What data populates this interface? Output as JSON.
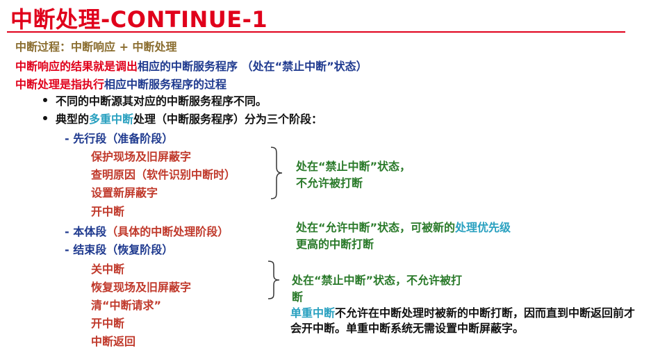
{
  "title": "中断处理-CONTINUE-1",
  "colors": {
    "red": "#e0001b",
    "brown": "#8a6d2f",
    "blue": "#1f3a8f",
    "green": "#2a7a2a",
    "teal": "#2aa1c0",
    "darkred": "#c0392b"
  },
  "line1": {
    "text": "中断过程：中断响应 + 中断处理"
  },
  "line2": {
    "p1": "中断响应的结果就是",
    "p2": "调出",
    "p3": "相应的中断服务程序 （处在“禁止中断”状态）"
  },
  "line3": {
    "p1": "中断处理是指",
    "p2": "执行",
    "p3": "相应中断服务程序的过程"
  },
  "bullet1": {
    "text": "不同的中断源其对应的中断服务程序不同。"
  },
  "bullet2": {
    "p1": "典型的",
    "p2": "多重中断",
    "p3": "处理（中断服务程序）分为三个阶段："
  },
  "stage1": {
    "label": "- 先行段（准备阶段）",
    "items": [
      "保护现场及旧屏蔽字",
      "查明原因（软件识别中断时）",
      "设置新屏蔽字",
      "开中断"
    ]
  },
  "stage2": {
    "p1": "- 本体段",
    "p2": "（具体的中断处理阶段）"
  },
  "stage3": {
    "label": "- 结束段（恢复阶段）",
    "items": [
      "关中断",
      "恢复现场及旧屏蔽字",
      "清“中断请求”",
      "开中断",
      "中断返回"
    ]
  },
  "note1": {
    "l1": "处在“禁止中断”状态，",
    "l2": "不允许被打断"
  },
  "note2": {
    "p1": "处在“允许中断”状态，可被新的",
    "p2": "处理优先级",
    "l2": "更高的中断打断"
  },
  "note3": {
    "l1": "处在“禁止中断”状态，不允许被打",
    "l2": "断"
  },
  "summary": {
    "p1": "单重中断",
    "p2": "不允许在中断处理时被新的中断打断，因而直到中断返回前才会开中断。单重中断系统无需设置中断屏蔽字。"
  }
}
